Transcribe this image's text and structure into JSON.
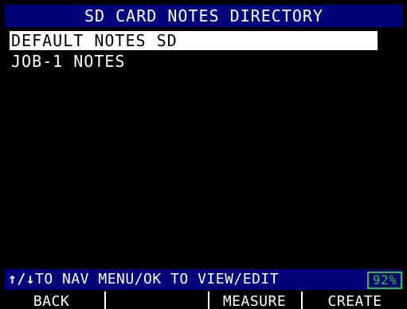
{
  "title": "SD CARD NOTES DIRECTORY",
  "list": {
    "items": [
      {
        "label": "DEFAULT NOTES SD",
        "selected": true
      },
      {
        "label": "JOB-1 NOTES",
        "selected": false
      }
    ]
  },
  "status": {
    "nav_arrows": "↑/↓",
    "hint": "TO NAV MENU/OK TO VIEW/EDIT",
    "battery": "92%"
  },
  "softkeys": {
    "k1": "BACK",
    "k2": "",
    "k3": "MEASURE",
    "k4": "CREATE"
  },
  "colors": {
    "screen_bg": "#000000",
    "bar_bg": "#00007a",
    "text": "#ffffff",
    "battery": "#22cc22",
    "selection_bg": "#ffffff"
  },
  "icons": {
    "nav": "up-down-arrows-icon",
    "battery": "battery-indicator"
  }
}
